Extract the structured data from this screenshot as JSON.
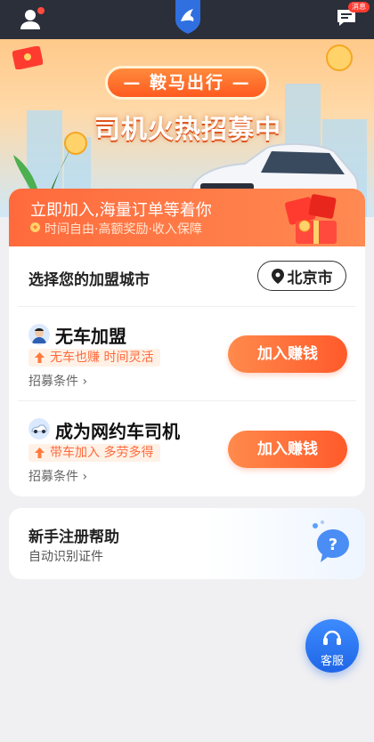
{
  "topbar": {
    "msg_badge": "消息"
  },
  "banner": {
    "brand_tag": "— 鞍马出行 —",
    "headline": "司机火热招募中"
  },
  "promo": {
    "title": "立即加入,海量订单等着你",
    "subtitle": "时间自由·高额奖励·收入保障"
  },
  "city": {
    "label": "选择您的加盟城市",
    "value": "北京市"
  },
  "options": [
    {
      "title": "无车加盟",
      "tag": "无车也赚 时间灵活",
      "conditions": "招募条件 ›",
      "button": "加入赚钱"
    },
    {
      "title": "成为网约车司机",
      "tag": "带车加入 多劳多得",
      "conditions": "招募条件 ›",
      "button": "加入赚钱"
    }
  ],
  "help": {
    "title": "新手注册帮助",
    "subtitle": "自动识别证件"
  },
  "service": {
    "label": "客服"
  },
  "colors": {
    "accent": "#ff5a2a",
    "topbar": "#2b2f3a",
    "service": "#1f66e6"
  }
}
